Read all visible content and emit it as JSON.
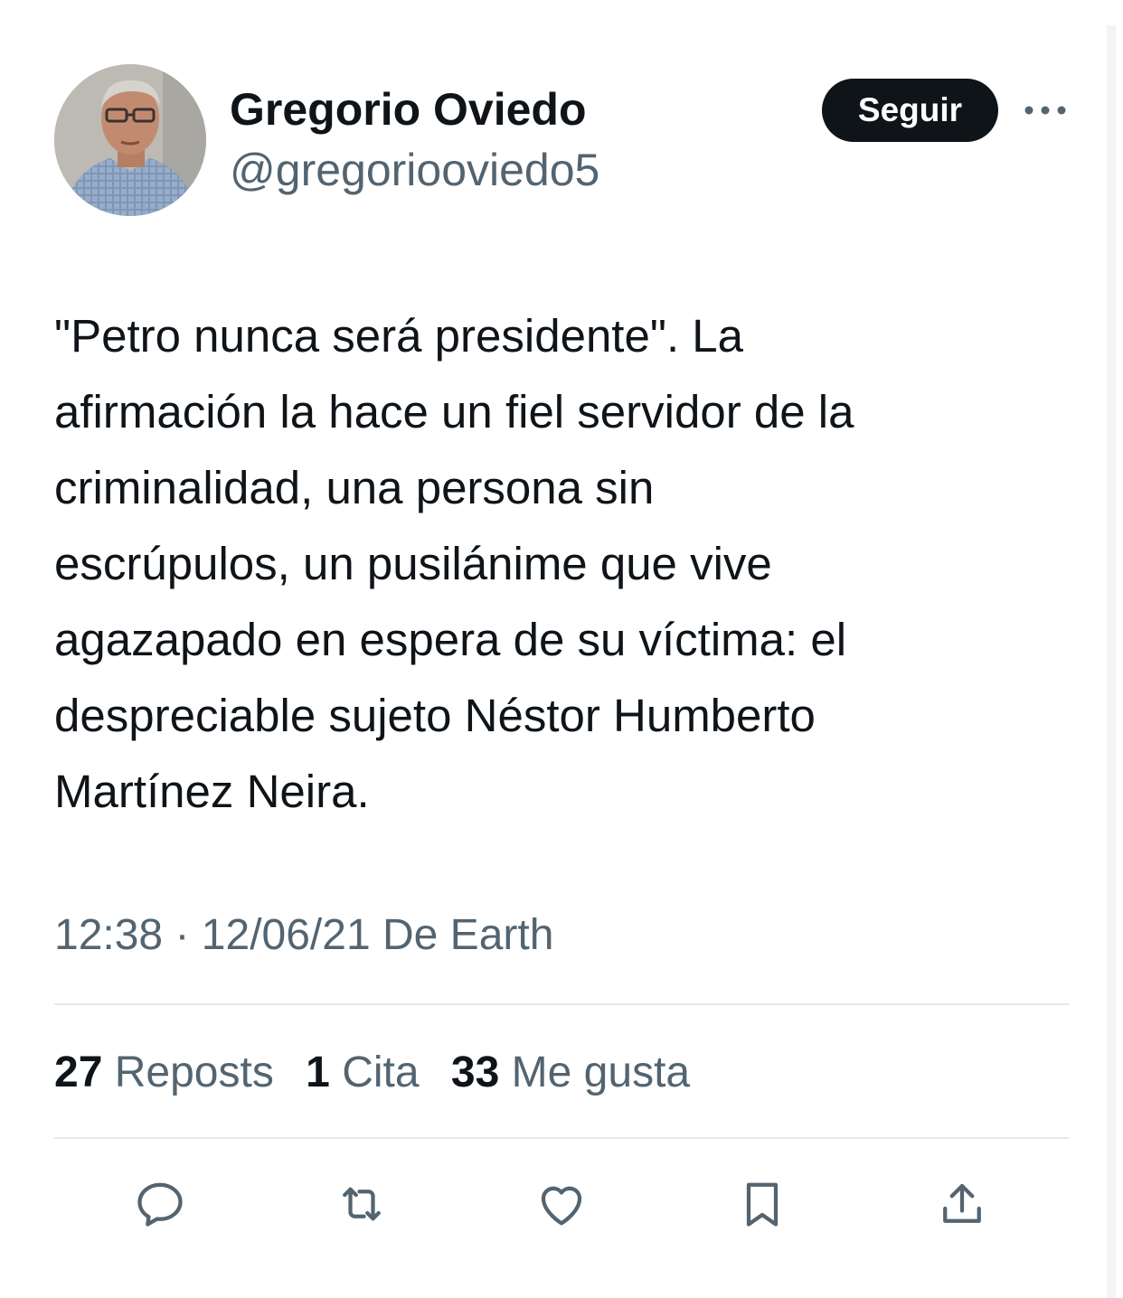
{
  "author": {
    "name": "Gregorio Oviedo",
    "handle": "@gregoriooviedo5",
    "avatar_icon": "profile-photo"
  },
  "follow_button_label": "Seguir",
  "more_icon": "more-horizontal-icon",
  "tweet": {
    "text": "\"Petro nunca será presidente\". La\nafirmación la hace un fiel servidor de la\ncriminalidad, una persona sin\nescrúpulos, un pusilánime que vive\nagazapado en espera de su víctima: el\ndespreciable sujeto Néstor Humberto\nMartínez Neira.",
    "time": "12:38",
    "separator": "·",
    "date": "12/06/21",
    "source": "De Earth"
  },
  "stats": {
    "reposts_count": "27",
    "reposts_label": "Reposts",
    "quotes_count": "1",
    "quotes_label": "Cita",
    "likes_count": "33",
    "likes_label": "Me gusta"
  },
  "actions": [
    "reply-icon",
    "repost-icon",
    "like-icon",
    "bookmark-icon",
    "share-icon"
  ],
  "colors": {
    "text_primary": "#0f1419",
    "text_secondary": "#536471",
    "divider": "#e6e8ea",
    "button_bg": "#0f1419",
    "button_text": "#ffffff"
  }
}
